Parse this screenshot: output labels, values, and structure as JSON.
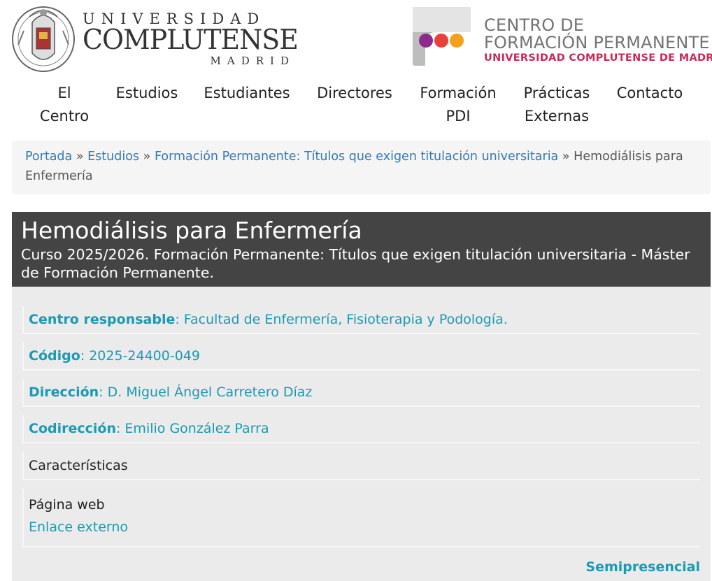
{
  "header": {
    "ucm": {
      "line1": "UNIVERSIDAD",
      "line2": "COMPLUTENSE",
      "line3": "MADRID"
    },
    "cfp": {
      "line1": "CENTRO DE",
      "line2": "FORMACIÓN PERMANENTE",
      "line3": "UNIVERSIDAD COMPLUTENSE DE MADRID"
    },
    "colors": {
      "dot1": "#8e2a8e",
      "dot2": "#e8413c",
      "dot3": "#f3a11d",
      "accent_red": "#c92a56"
    }
  },
  "nav": {
    "items": [
      {
        "line1": "El",
        "line2": "Centro"
      },
      {
        "line1": "Estudios",
        "line2": ""
      },
      {
        "line1": "Estudiantes",
        "line2": ""
      },
      {
        "line1": "Directores",
        "line2": ""
      },
      {
        "line1": "Formación",
        "line2": "PDI"
      },
      {
        "line1": "Prácticas",
        "line2": "Externas"
      },
      {
        "line1": "Contacto",
        "line2": ""
      }
    ]
  },
  "breadcrumb": {
    "links": [
      "Portada",
      "Estudios",
      "Formación Permanente: Títulos que exigen titulación universitaria"
    ],
    "separator": "»",
    "current_a": "Hemodiálisis para",
    "current_b": "Enfermería"
  },
  "course": {
    "title": "Hemodiálisis para Enfermería",
    "subtitle_a": "Curso 2025/2026. Formación Permanente: Títulos que exigen titulación universitaria - Máster",
    "subtitle_b": "de Formación Permanente."
  },
  "details": {
    "centro": {
      "label": "Centro responsable",
      "value": ": Facultad de Enfermería, Fisioterapia y Podología."
    },
    "codigo": {
      "label": "Código",
      "value": ": 2025-24400-049"
    },
    "direccion": {
      "label": "Dirección",
      "value": ": D. Miguel Ángel Carretero Díaz"
    },
    "codireccion": {
      "label": "Codirección",
      "value": ": Emilio González Parra"
    },
    "caracteristicas": "Características",
    "pagina_web": {
      "label": "Página web",
      "link": "Enlace externo"
    },
    "modality": "Semipresencial"
  }
}
